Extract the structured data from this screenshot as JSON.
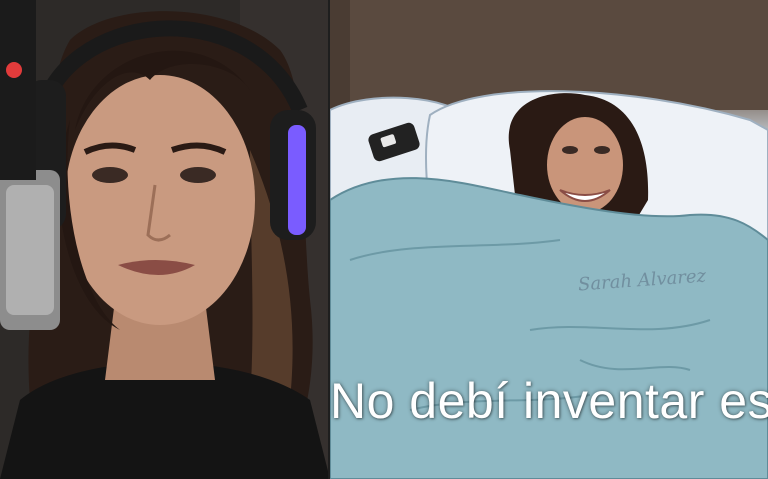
{
  "left_panel": {
    "subject": "woman-with-headphones-at-microphone",
    "colors": {
      "background": "#2b2826",
      "headphones_accent": "#7a5cff",
      "mic_light": "#e23b3b",
      "shirt": "#141414"
    }
  },
  "right_panel": {
    "subject": "cartoon-bed-with-pasted-smiling-face",
    "caption": "No debí inventar es",
    "signature": "Sarah Alvarez",
    "colors": {
      "blanket": "#8fb9c4",
      "pillow": "#e8edf3",
      "wall": "#5a4a3f",
      "caption": "#ffffff"
    }
  }
}
